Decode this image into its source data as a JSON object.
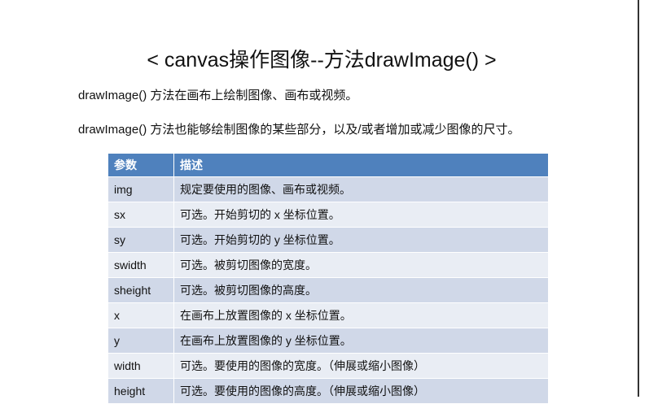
{
  "title": "< canvas操作图像--方法drawImage() >",
  "paragraphs": [
    "drawImage() 方法在画布上绘制图像、画布或视频。",
    "drawImage() 方法也能够绘制图像的某些部分，以及/或者增加或减少图像的尺寸。"
  ],
  "table": {
    "headers": [
      "参数",
      "描述"
    ],
    "rows": [
      [
        "img",
        "规定要使用的图像、画布或视频。"
      ],
      [
        "sx",
        "可选。开始剪切的 x 坐标位置。"
      ],
      [
        "sy",
        "可选。开始剪切的 y 坐标位置。"
      ],
      [
        "swidth",
        "可选。被剪切图像的宽度。"
      ],
      [
        "sheight",
        "可选。被剪切图像的高度。"
      ],
      [
        "x",
        "在画布上放置图像的 x 坐标位置。"
      ],
      [
        "y",
        "在画布上放置图像的 y 坐标位置。"
      ],
      [
        "width",
        "可选。要使用的图像的宽度。（伸展或缩小图像）"
      ],
      [
        "height",
        "可选。要使用的图像的高度。（伸展或缩小图像）"
      ]
    ]
  }
}
